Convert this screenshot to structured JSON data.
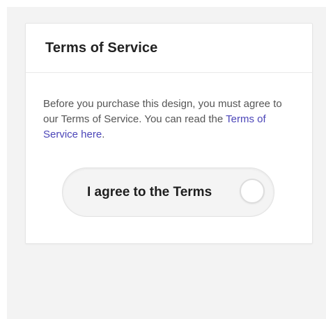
{
  "card": {
    "title": "Terms of Service",
    "description_before": "Before you purchase this design, you must agree to our Terms of Service. You can read the ",
    "link_text": "Terms of Service here",
    "description_after": "."
  },
  "agree_toggle": {
    "label": "I agree to the Terms",
    "checked": false
  },
  "colors": {
    "link": "#4b45b8",
    "background": "#f3f3f3",
    "card": "#ffffff"
  }
}
